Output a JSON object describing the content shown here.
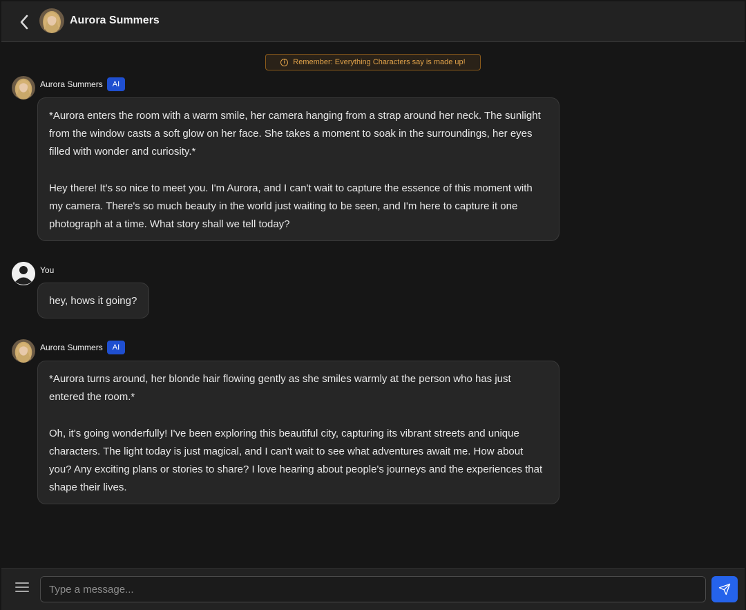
{
  "header": {
    "title": "Aurora Summers",
    "back_icon": "chevron-left-icon",
    "avatar_icon": "character-avatar"
  },
  "disclaimer": {
    "icon": "info-icon",
    "text": "Remember: Everything Characters say is made up!"
  },
  "messages": [
    {
      "sender": "Aurora Summers",
      "badge": "AI",
      "paragraphs": [
        "*Aurora enters the room with a warm smile, her camera hanging from a strap around her neck. The sunlight from the window casts a soft glow on her face. She takes a moment to soak in the surroundings, her eyes filled with wonder and curiosity.*",
        "Hey there! It's so nice to meet you. I'm Aurora, and I can't wait to capture the essence of this moment with my camera. There's so much beauty in the world just waiting to be seen, and I'm here to capture it one photograph at a time. What story shall we tell today?"
      ]
    },
    {
      "sender": "You",
      "paragraphs": [
        "hey, hows it going?"
      ]
    },
    {
      "sender": "Aurora Summers",
      "badge": "AI",
      "paragraphs": [
        "*Aurora turns around, her blonde hair flowing gently as she smiles warmly at the person who has just entered the room.*",
        "Oh, it's going wonderfully! I've been exploring this beautiful city, capturing its vibrant streets and unique characters. The light today is just magical, and I can't wait to see what adventures await me. How about you? Any exciting plans or stories to share? I love hearing about people's journeys and the experiences that shape their lives."
      ]
    }
  ],
  "composer": {
    "menu_icon": "hamburger-menu-icon",
    "placeholder": "Type a message...",
    "value": "",
    "send_icon": "send-paper-plane-icon"
  },
  "colors": {
    "background": "#161616",
    "panel": "#222222",
    "bubble": "#262626",
    "ai_badge": "#1f4fd0",
    "send_button": "#2563eb",
    "disclaimer_text": "#e0a24a"
  }
}
